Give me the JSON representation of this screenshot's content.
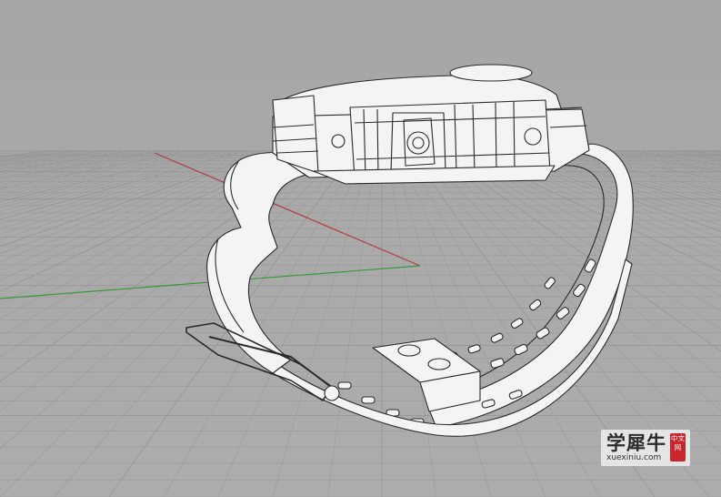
{
  "viewport": {
    "background": "#a8a8a8",
    "grid_color": "#9a9a9a",
    "grid_major_color": "#8e8e8e",
    "axis_x_color": "#b23a3a",
    "axis_y_color": "#3a9a3a",
    "wire_color": "#2a2a2a",
    "surface_color": "#f4f4f4"
  },
  "watermark": {
    "brand": "学犀牛",
    "url": "xuexiniu.com",
    "seal": "中文网"
  }
}
